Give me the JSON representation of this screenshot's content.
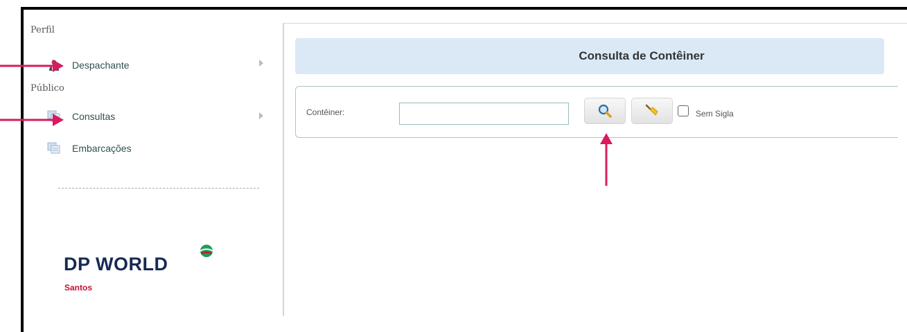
{
  "sidebar": {
    "sections": [
      {
        "title": "Perfil"
      },
      {
        "title": "Público"
      }
    ],
    "items": [
      {
        "label": "Despachante",
        "icon": "user-icon",
        "has_submenu": true
      },
      {
        "label": "Consultas",
        "icon": "documents-icon",
        "has_submenu": true
      },
      {
        "label": "Embarcações",
        "icon": "documents-icon",
        "has_submenu": false
      }
    ]
  },
  "logo": {
    "main": "DP WORLD",
    "sub": "Santos"
  },
  "main": {
    "title": "Consulta de Contêiner",
    "filter": {
      "container_label": "Contêiner:",
      "container_value": "",
      "search_icon": "magnifier-icon",
      "clear_icon": "broom-icon",
      "checkbox_label": "Sem Sigla",
      "checkbox_checked": false
    }
  },
  "colors": {
    "annotation_arrow": "#d81b60",
    "title_bar": "#dbe9f6",
    "logo_navy": "#172a54",
    "logo_red": "#c8102e"
  }
}
